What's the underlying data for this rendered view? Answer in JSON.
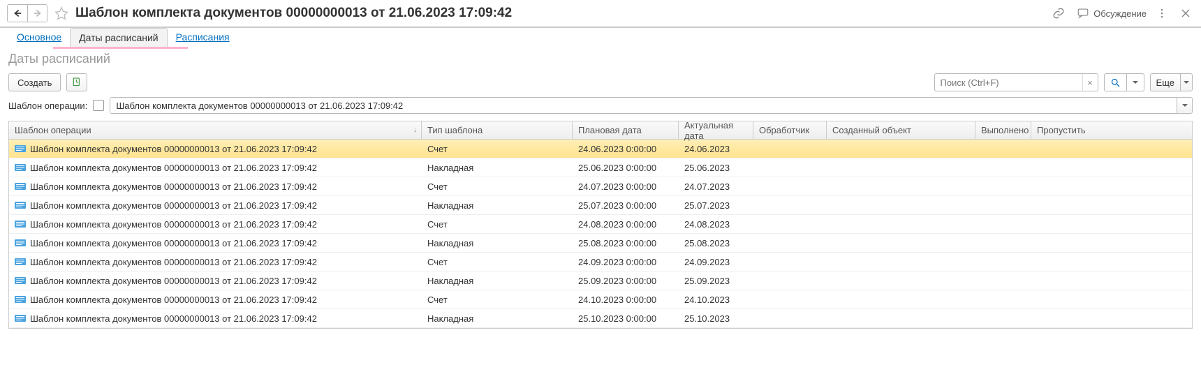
{
  "header": {
    "title": "Шаблон комплекта документов 00000000013 от 21.06.2023 17:09:42",
    "discuss": "Обсуждение"
  },
  "tabs": [
    "Основное",
    "Даты расписаний",
    "Расписания"
  ],
  "activeTab": 1,
  "subtitle": "Даты расписаний",
  "toolbar": {
    "create": "Создать",
    "searchPlaceholder": "Поиск (Ctrl+F)",
    "more": "Еще"
  },
  "filter": {
    "label": "Шаблон операции:",
    "checked": false,
    "value": "Шаблон комплекта документов 00000000013 от 21.06.2023 17:09:42"
  },
  "grid": {
    "columns": [
      "Шаблон операции",
      "Тип шаблона",
      "Плановая дата",
      "Актуальная дата",
      "Обработчик",
      "Созданный объект",
      "Выполнено",
      "Пропустить"
    ],
    "sortCol": 0,
    "sortDir": "↓",
    "rows": [
      {
        "op": "Шаблон комплекта документов 00000000013 от 21.06.2023 17:09:42",
        "type": "Счет",
        "plan": "24.06.2023 0:00:00",
        "actual": "24.06.2023",
        "selected": true
      },
      {
        "op": "Шаблон комплекта документов 00000000013 от 21.06.2023 17:09:42",
        "type": "Накладная",
        "plan": "25.06.2023 0:00:00",
        "actual": "25.06.2023"
      },
      {
        "op": "Шаблон комплекта документов 00000000013 от 21.06.2023 17:09:42",
        "type": "Счет",
        "plan": "24.07.2023 0:00:00",
        "actual": "24.07.2023"
      },
      {
        "op": "Шаблон комплекта документов 00000000013 от 21.06.2023 17:09:42",
        "type": "Накладная",
        "plan": "25.07.2023 0:00:00",
        "actual": "25.07.2023"
      },
      {
        "op": "Шаблон комплекта документов 00000000013 от 21.06.2023 17:09:42",
        "type": "Счет",
        "plan": "24.08.2023 0:00:00",
        "actual": "24.08.2023"
      },
      {
        "op": "Шаблон комплекта документов 00000000013 от 21.06.2023 17:09:42",
        "type": "Накладная",
        "plan": "25.08.2023 0:00:00",
        "actual": "25.08.2023"
      },
      {
        "op": "Шаблон комплекта документов 00000000013 от 21.06.2023 17:09:42",
        "type": "Счет",
        "plan": "24.09.2023 0:00:00",
        "actual": "24.09.2023"
      },
      {
        "op": "Шаблон комплекта документов 00000000013 от 21.06.2023 17:09:42",
        "type": "Накладная",
        "plan": "25.09.2023 0:00:00",
        "actual": "25.09.2023"
      },
      {
        "op": "Шаблон комплекта документов 00000000013 от 21.06.2023 17:09:42",
        "type": "Счет",
        "plan": "24.10.2023 0:00:00",
        "actual": "24.10.2023"
      },
      {
        "op": "Шаблон комплекта документов 00000000013 от 21.06.2023 17:09:42",
        "type": "Накладная",
        "plan": "25.10.2023 0:00:00",
        "actual": "25.10.2023"
      }
    ]
  }
}
